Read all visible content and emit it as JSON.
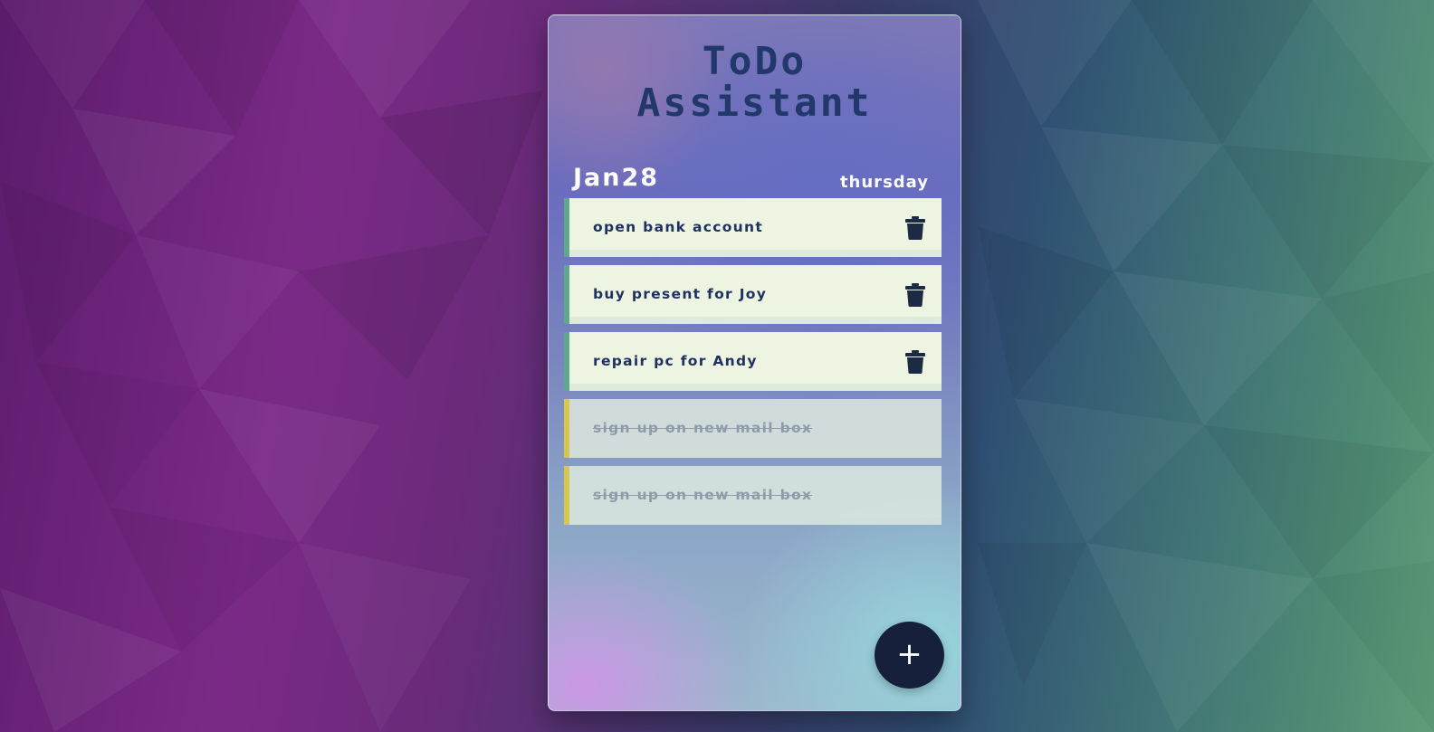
{
  "app": {
    "title_line1": "ToDo",
    "title_line2": "Assistant"
  },
  "header": {
    "date": "Jan28",
    "weekday": "thursday"
  },
  "tasks": [
    {
      "label": "open bank account",
      "done": false,
      "icon": "trash-icon"
    },
    {
      "label": "buy present for Joy",
      "done": false,
      "icon": "trash-icon"
    },
    {
      "label": "repair pc for Andy",
      "done": false,
      "icon": "trash-icon"
    },
    {
      "label": "sign up on new mail box",
      "done": true
    },
    {
      "label": "sign up on new mail box",
      "done": true
    }
  ],
  "actions": {
    "add_label": "+"
  },
  "colors": {
    "title": "#22386a",
    "task_bg": "#eef4e2",
    "task_accent_active": "#5fa889",
    "task_accent_done": "#d8c84a",
    "add_button": "#16203a"
  }
}
